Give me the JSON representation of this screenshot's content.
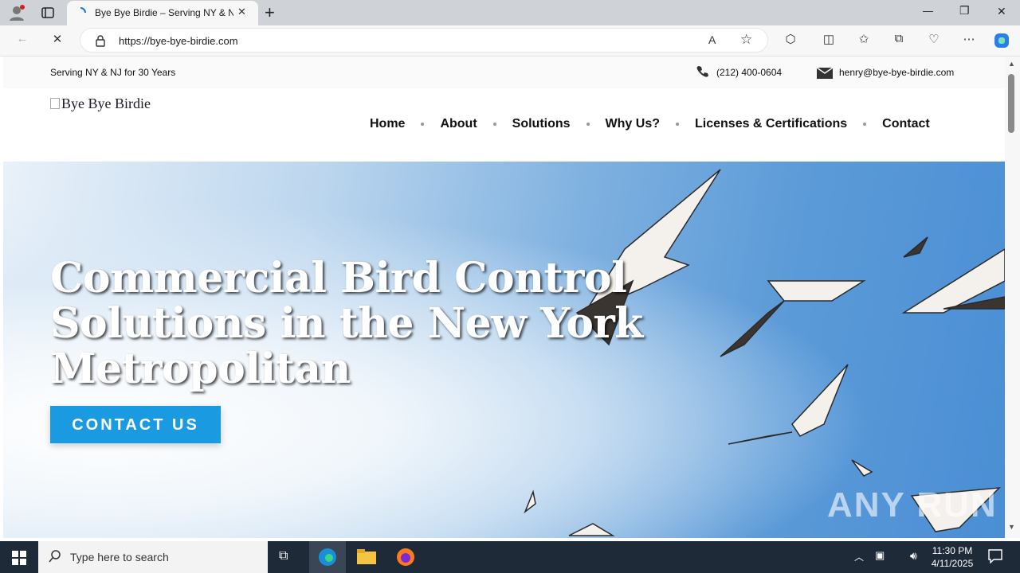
{
  "browser": {
    "tab_title": "Bye Bye Birdie – Serving NY & NJ",
    "tab_close": "✕",
    "new_tab": "+",
    "url": "https://bye-bye-birdie.com",
    "window_min": "—",
    "window_restore": "❐",
    "window_close": "✕"
  },
  "topbar": {
    "tagline": "Serving NY & NJ for 30 Years",
    "phone": "(212) 400-0604",
    "email": "henry@bye-bye-birdie.com"
  },
  "header": {
    "logo_alt": "Bye Bye Birdie",
    "nav": [
      "Home",
      "About",
      "Solutions",
      "Why Us?",
      "Licenses & Certifications",
      "Contact"
    ]
  },
  "hero": {
    "title": "Commercial Bird Control Solutions in the New York Metropolitan",
    "cta": "CONTACT US"
  },
  "watermark": "ANY RUN",
  "taskbar": {
    "search_placeholder": "Type here to search",
    "time": "11:30 PM",
    "date": "4/11/2025"
  },
  "colors": {
    "cta": "#1a9ae0",
    "sky": "#5c9bd8"
  }
}
